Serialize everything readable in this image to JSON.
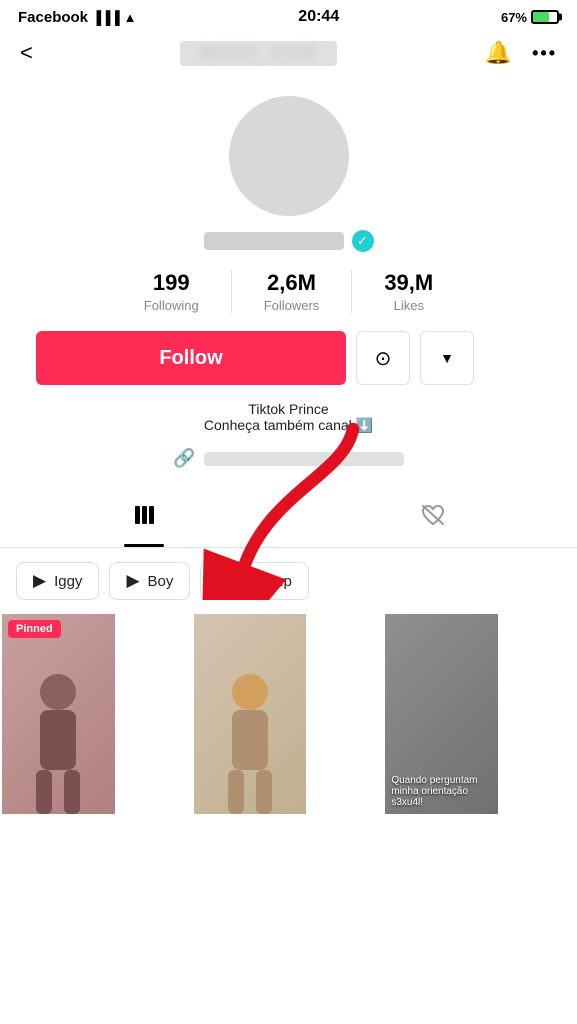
{
  "statusBar": {
    "app": "Facebook",
    "time": "20:44",
    "battery": "67%"
  },
  "topNav": {
    "backLabel": "<",
    "titleBlurred": "...........",
    "bellIcon": "🔔",
    "moreIcon": "•••"
  },
  "profile": {
    "usernameBlurred": true,
    "verifiedColor": "#20c0c0",
    "stats": [
      {
        "value": "199",
        "label": "Following"
      },
      {
        "value": "2,6M",
        "label": "Followers"
      },
      {
        "value": "39,M",
        "label": "Likes"
      }
    ],
    "followLabel": "Follow",
    "bio": [
      "Tiktok Prince",
      "Conheça também canal ⬇️"
    ],
    "linkBlurred": true
  },
  "tabs": [
    {
      "id": "videos",
      "icon": "|||",
      "active": true
    },
    {
      "id": "liked",
      "icon": "♡~",
      "active": false
    }
  ],
  "chips": [
    {
      "label": "Iggy",
      "icon": "▶"
    },
    {
      "label": "Boy",
      "icon": "▶"
    },
    {
      "label": "Makeup",
      "icon": "▶"
    }
  ],
  "videos": [
    {
      "id": 1,
      "pinned": true,
      "caption": ""
    },
    {
      "id": 2,
      "pinned": false,
      "caption": ""
    },
    {
      "id": 3,
      "pinned": false,
      "caption": "Quando perguntam minha orientação s3xu4l!"
    }
  ]
}
